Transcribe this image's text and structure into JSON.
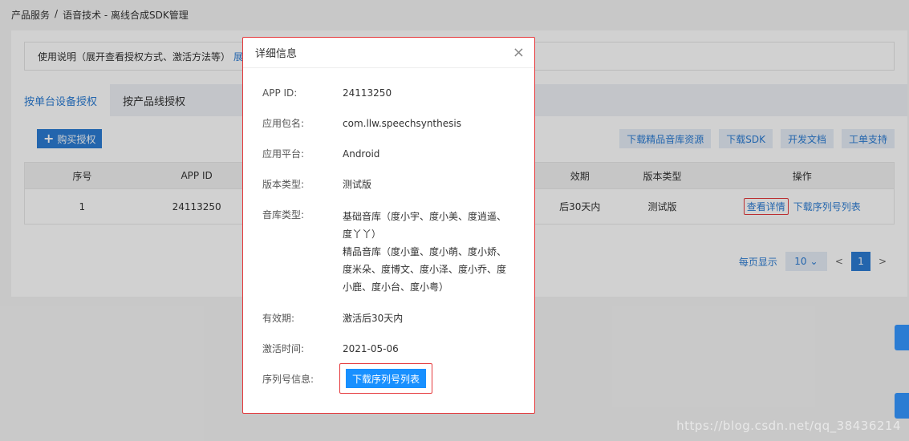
{
  "breadcrumb": [
    "产品服务",
    "/",
    "语音技术 - 离线合成SDK管理"
  ],
  "notice": {
    "text": "使用说明（展开查看授权方式、激活方法等）",
    "link": "展"
  },
  "tabs": [
    "按单台设备授权",
    "按产品线授权"
  ],
  "buy_button": "购买授权",
  "actions": [
    "下载精品音库资源",
    "下载SDK",
    "开发文档",
    "工单支持"
  ],
  "table": {
    "headers": [
      "序号",
      "APP ID",
      "",
      "效期",
      "版本类型",
      "操作"
    ],
    "row": {
      "index": "1",
      "appid": "24113250",
      "validity": "后30天内",
      "version": "测试版",
      "detail": "查看详情",
      "serial": "下载序列号列表"
    }
  },
  "pagination": {
    "label": "每页显示",
    "size": "10",
    "page": "1",
    "prev": "<",
    "next": ">"
  },
  "modal": {
    "title": "详细信息",
    "close": "×",
    "rows": [
      {
        "k": "APP ID:",
        "v": "24113250"
      },
      {
        "k": "应用包名:",
        "v": "com.llw.speechsynthesis"
      },
      {
        "k": "应用平台:",
        "v": "Android"
      },
      {
        "k": "版本类型:",
        "v": "测试版"
      }
    ],
    "library": {
      "k": "音库类型:",
      "basic": "基础音库（度小宇、度小美、度逍遥、度丫丫）",
      "premium": "精品音库（度小童、度小萌、度小娇、度米朵、度博文、度小泽、度小乔、度小鹿、度小台、度小粤）"
    },
    "validity": {
      "k": "有效期:",
      "v": "激活后30天内"
    },
    "activate": {
      "k": "激活时间:",
      "v": "2021-05-06"
    },
    "serial": {
      "k": "序列号信息:",
      "button": "下载序列号列表"
    }
  },
  "watermark": "https://blog.csdn.net/qq_38436214",
  "colors": {
    "primary": "#2b7cd3",
    "highlight": "#e5393c"
  }
}
